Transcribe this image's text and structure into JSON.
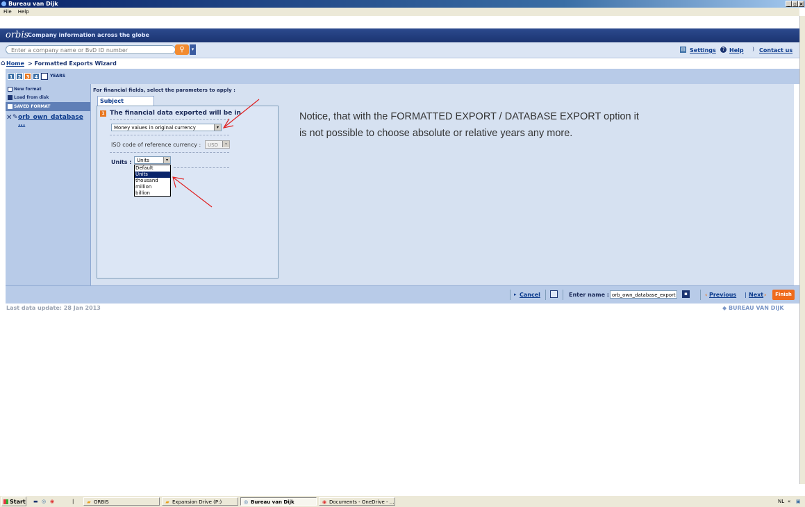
{
  "window": {
    "title": "Bureau van Dijk"
  },
  "menu": [
    "File",
    "Help"
  ],
  "app": {
    "logo": "orbis",
    "tagline": "Company information across the globe",
    "search_placeholder": "Enter a company name or BvD ID number",
    "top_links": {
      "settings": "Settings",
      "help": "Help",
      "contact": "Contact us"
    }
  },
  "breadcrumb": {
    "home": "Home",
    "rest": " > Formatted Exports Wizard"
  },
  "steps": {
    "items": [
      "1",
      "2",
      "3",
      "4"
    ],
    "label": "YEARS"
  },
  "sidebar": {
    "new_format": "New format",
    "load_from_disk": "Load from disk",
    "saved_format": "SAVED FORMAT",
    "saved_item": "orb_own_database ..."
  },
  "main": {
    "title": "For financial fields, select the parameters to apply :",
    "tab": "Subject company",
    "question_number": "1",
    "question": "The financial data exported will be in",
    "money_select": "Money values in original currency",
    "iso_label": "ISO code of reference currency :",
    "iso_value": "USD",
    "units_label": "Units :",
    "units_value": "Units",
    "units_options": [
      "Default",
      "Units",
      "thousand",
      "million",
      "billion"
    ],
    "units_selected_index": 1
  },
  "notice": "Notice, that with the FORMATTED EXPORT / DATABASE EXPORT option it is not possible to choose absolute or relative years any more.",
  "bottom": {
    "cancel": "Cancel",
    "enter_name_label": "Enter name :",
    "name_value": "orb_own_database_export",
    "previous": "Previous",
    "next": "Next",
    "finish": "Finish"
  },
  "footer": {
    "last_update": "Last data update: 28 Jan 2013",
    "brand": "BUREAU VAN DIJK"
  },
  "taskbar": {
    "start": "Start",
    "windows": [
      "ORBIS",
      "Expansion Drive (P:)",
      "Bureau van Dijk",
      "Documents - OneDrive - ..."
    ],
    "tray": [
      "NL",
      "«"
    ]
  },
  "colors": {
    "header": "#1b3471",
    "panel": "#b8cbe8",
    "accent": "#ef6b1c",
    "annotation": "#e02020"
  }
}
